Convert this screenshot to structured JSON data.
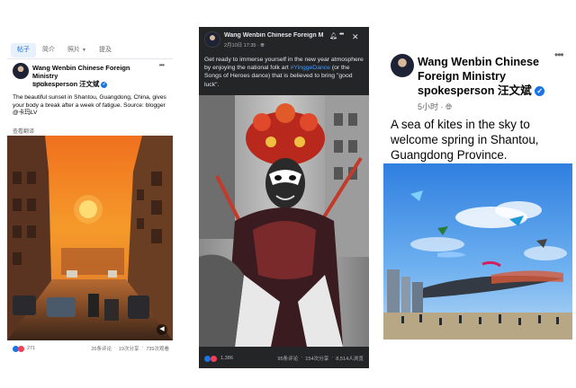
{
  "panel1": {
    "tabs": [
      {
        "label": "帖子"
      },
      {
        "label": "简介"
      },
      {
        "label": "照片"
      },
      {
        "label": "提及"
      }
    ],
    "author_line1": "Wang Wenbin Chinese Foreign Ministry",
    "author_line2": "spokesperson 汪文斌",
    "timestamp": "昨天10:57 · ",
    "body": "The beautiful sunset in Shantou, Guangdong, China, gives your body a break after a week of fatigue. Source: blogger @卡玛LV",
    "see_translation": "查看翻译",
    "reactions_count": "271",
    "comments": "26条评论",
    "shares": "19次分享",
    "views": "739次观看"
  },
  "panel2": {
    "author": "Wang Wenbin Chinese Foreign Minis...",
    "timestamp": "2月10日 17:35 · ",
    "body_before": "Get ready to immerse yourself in the new year atmosphere by enjoying the national folk art ",
    "hashtag": "#YinggeDance",
    "body_after": " (or the Songs of Heroes dance) that is believed to bring \"good luck\".",
    "reactions_count": "1,386",
    "comments": "95条评论",
    "shares": "154次分享",
    "views": "8,514人浏览"
  },
  "panel3": {
    "author_line1": "Wang Wenbin Chinese",
    "author_line2": "Foreign Ministry",
    "author_line3": "spokesperson 汪文斌",
    "timestamp": "5小时 · ",
    "body": "A sea of kites in the sky to welcome spring in Shantou, Guangdong Province."
  },
  "icons": {
    "verified": "verified-badge-icon",
    "globe": "globe-icon",
    "more": "more-options-icon",
    "close": "close-icon",
    "bell": "bell-icon",
    "volume": "volume-icon"
  },
  "colors": {
    "facebook_blue": "#1b74e4",
    "hashtag_blue": "#4599ff",
    "dark_card": "#242526",
    "love_red": "#f33e58"
  }
}
